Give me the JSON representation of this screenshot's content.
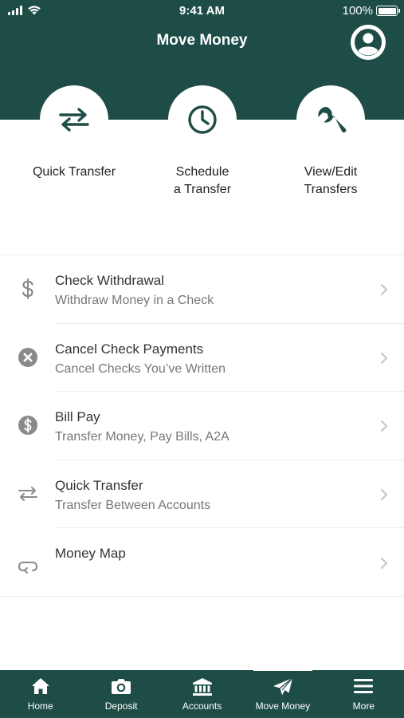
{
  "status": {
    "time": "9:41 AM",
    "battery": "100%"
  },
  "header": {
    "title": "Move Money"
  },
  "actions": [
    {
      "label": "Quick Transfer",
      "icon": "transfer-arrows-icon"
    },
    {
      "label": "Schedule\na Transfer",
      "icon": "clock-icon"
    },
    {
      "label": "View/Edit\nTransfers",
      "icon": "wrench-icon"
    }
  ],
  "list": [
    {
      "title": "Check Withdrawal",
      "subtitle": "Withdraw Money in a Check",
      "icon": "dollar-sign-icon"
    },
    {
      "title": "Cancel Check Payments",
      "subtitle": "Cancel Checks You’ve Written",
      "icon": "cancel-circle-icon"
    },
    {
      "title": "Bill Pay",
      "subtitle": "Transfer Money, Pay Bills, A2A",
      "icon": "dollar-circle-icon"
    },
    {
      "title": "Quick Transfer",
      "subtitle": "Transfer Between Accounts",
      "icon": "transfer-arrows-icon"
    },
    {
      "title": "Money Map",
      "subtitle": "",
      "icon": "map-icon"
    }
  ],
  "tabs": [
    {
      "label": "Home",
      "icon": "home-icon"
    },
    {
      "label": "Deposit",
      "icon": "camera-icon"
    },
    {
      "label": "Accounts",
      "icon": "bank-icon"
    },
    {
      "label": "Move Money",
      "icon": "paper-plane-icon",
      "active": true
    },
    {
      "label": "More",
      "icon": "menu-icon"
    }
  ],
  "colors": {
    "brand": "#1d4d46",
    "background": "#ffffff",
    "icon_gray": "#8a8a8a"
  }
}
